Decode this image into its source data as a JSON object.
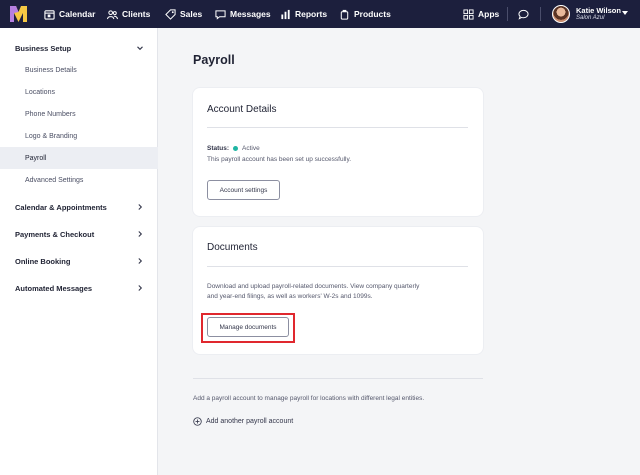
{
  "topnav": {
    "items": [
      {
        "label": "Calendar",
        "icon": "calendar-icon"
      },
      {
        "label": "Clients",
        "icon": "clients-icon"
      },
      {
        "label": "Sales",
        "icon": "sales-tag-icon"
      },
      {
        "label": "Messages",
        "icon": "messages-icon"
      },
      {
        "label": "Reports",
        "icon": "reports-icon"
      },
      {
        "label": "Products",
        "icon": "products-icon"
      }
    ],
    "apps_label": "Apps",
    "user": {
      "name": "Katie Wilson",
      "business": "Salon Azul"
    }
  },
  "sidebar": {
    "business_setup": "Business Setup",
    "sub_items": [
      "Business Details",
      "Locations",
      "Phone Numbers",
      "Logo & Branding",
      "Payroll",
      "Advanced Settings"
    ],
    "active_sub": "Payroll",
    "sections": [
      "Calendar & Appointments",
      "Payments & Checkout",
      "Online Booking",
      "Automated Messages"
    ]
  },
  "page": {
    "title": "Payroll",
    "account_card": {
      "title": "Account Details",
      "status_label": "Status:",
      "status_value": "Active",
      "status_message": "This payroll account has been set up successfully.",
      "button": "Account settings"
    },
    "documents_card": {
      "title": "Documents",
      "description_line1": "Download and upload payroll-related documents. View company quarterly",
      "description_line2": "and year-end filings, as well as workers' W-2s and 1099s.",
      "button": "Manage documents"
    },
    "footer_note": "Add a payroll account to manage payroll for locations with different legal entities.",
    "add_link": "Add another payroll account"
  },
  "colors": {
    "nav_bg": "#1c1f3d",
    "status_active": "#1fb5a3",
    "highlight": "#e0282e"
  }
}
